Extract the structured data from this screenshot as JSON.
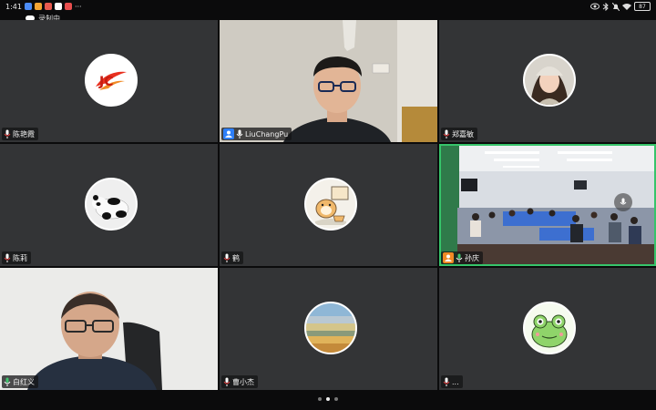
{
  "status_bar": {
    "time": "1:41",
    "battery": "87"
  },
  "recording": {
    "label": "录制中"
  },
  "participants": [
    {
      "name": "陈艳霞",
      "avatar": "logo-avatar"
    },
    {
      "name": "LiuChangPu",
      "avatar": "video"
    },
    {
      "name": "郑嘉敏",
      "avatar": "girl-photo-avatar"
    },
    {
      "name": "陈莉",
      "avatar": "panda-avatar"
    },
    {
      "name": "鹤",
      "avatar": "hamster-avatar"
    },
    {
      "name": "孙庆",
      "avatar": "video"
    },
    {
      "name": "白红义",
      "avatar": "video"
    },
    {
      "name": "曹小杰",
      "avatar": "landscape-avatar"
    },
    {
      "name": "...",
      "avatar": "frog-avatar"
    }
  ],
  "pager": {
    "pages": 3,
    "current": 2
  }
}
